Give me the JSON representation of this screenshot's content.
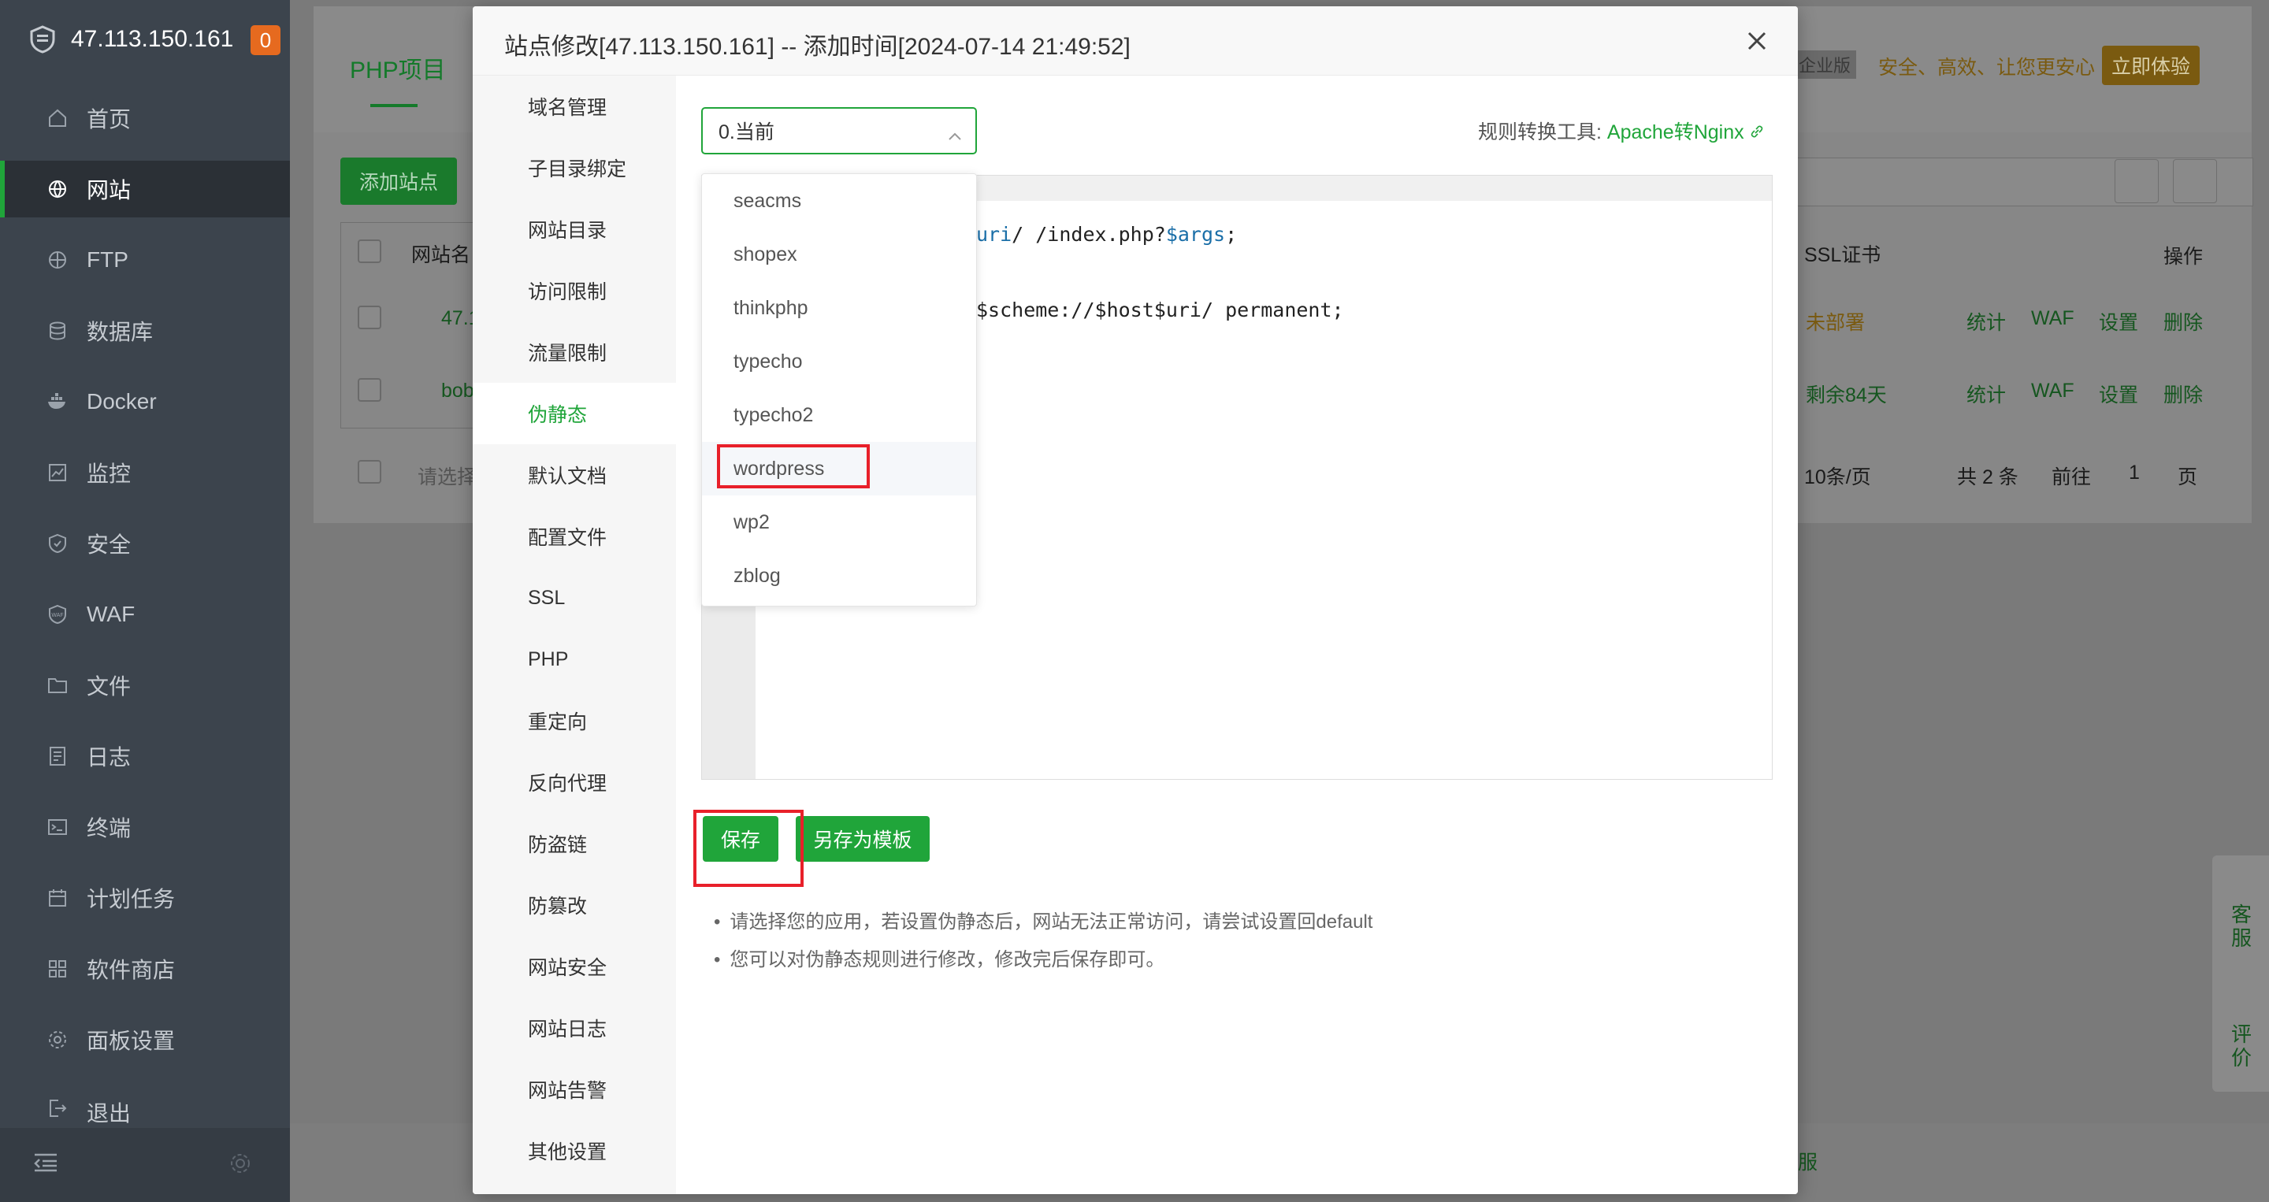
{
  "app": {
    "server_ip": "47.113.150.161",
    "notification_count": "0"
  },
  "sidebar": {
    "items": [
      {
        "label": "首页",
        "icon": "home-icon"
      },
      {
        "label": "网站",
        "icon": "globe-icon",
        "active": true
      },
      {
        "label": "FTP",
        "icon": "ftp-icon"
      },
      {
        "label": "数据库",
        "icon": "database-icon"
      },
      {
        "label": "Docker",
        "icon": "docker-icon"
      },
      {
        "label": "监控",
        "icon": "monitor-icon"
      },
      {
        "label": "安全",
        "icon": "shield-icon"
      },
      {
        "label": "WAF",
        "icon": "waf-icon"
      },
      {
        "label": "文件",
        "icon": "folder-icon"
      },
      {
        "label": "日志",
        "icon": "log-icon"
      },
      {
        "label": "终端",
        "icon": "terminal-icon"
      },
      {
        "label": "计划任务",
        "icon": "calendar-icon"
      },
      {
        "label": "软件商店",
        "icon": "grid-icon"
      },
      {
        "label": "面板设置",
        "icon": "gear-icon"
      },
      {
        "label": "退出",
        "icon": "logout-icon"
      }
    ]
  },
  "background": {
    "tab": "PHP项目",
    "add_site_button": "添加站点",
    "edition_badge": "企业版",
    "slogan": "安全、高效、让您更安心",
    "trial_button": "立即体验",
    "table": {
      "col_site": "网站名",
      "col_ssl": "SSL证书",
      "col_ops": "操作",
      "rows": [
        {
          "name": "47.1",
          "ssl": "未部署",
          "ops": [
            "统计",
            "WAF",
            "设置",
            "删除"
          ]
        },
        {
          "name": "bob",
          "ssl": "剩余84天",
          "ops": [
            "统计",
            "WAF",
            "设置",
            "删除"
          ]
        }
      ]
    },
    "batch_placeholder": "请选择",
    "pagination": {
      "page_size": "10条/页",
      "total": "共 2 条",
      "goto": "前往",
      "page": "1",
      "page_suffix": "页"
    },
    "footer_text": "服",
    "float_buttons": [
      "客服",
      "评价"
    ]
  },
  "modal": {
    "title": "站点修改[47.113.150.161] -- 添加时间[2024-07-14 21:49:52]",
    "nav": [
      "域名管理",
      "子目录绑定",
      "网站目录",
      "访问限制",
      "流量限制",
      "伪静态",
      "默认文档",
      "配置文件",
      "SSL",
      "PHP",
      "重定向",
      "反向代理",
      "防盗链",
      "防篡改",
      "网站安全",
      "网站日志",
      "网站告警",
      "其他设置"
    ],
    "active_nav": "伪静态",
    "rewrite": {
      "selected_template": "0.当前",
      "tool_label": "规则转换工具:",
      "tool_link": "Apache转Nginx",
      "code_line1_a": "uri",
      "code_line1_b": "/ /index.php?",
      "code_line1_c": "$args",
      "code_line1_d": ";",
      "code_line2": "$scheme://$host$uri/ permanent;",
      "dropdown_options": [
        "seacms",
        "shopex",
        "thinkphp",
        "typecho",
        "typecho2",
        "wordpress",
        "wp2",
        "zblog"
      ],
      "highlighted_option": "wordpress",
      "save_button": "保存",
      "save_template_button": "另存为模板",
      "notes": [
        "请选择您的应用，若设置伪静态后，网站无法正常访问，请尝试设置回default",
        "您可以对伪静态规则进行修改，修改完后保存即可。"
      ]
    }
  }
}
